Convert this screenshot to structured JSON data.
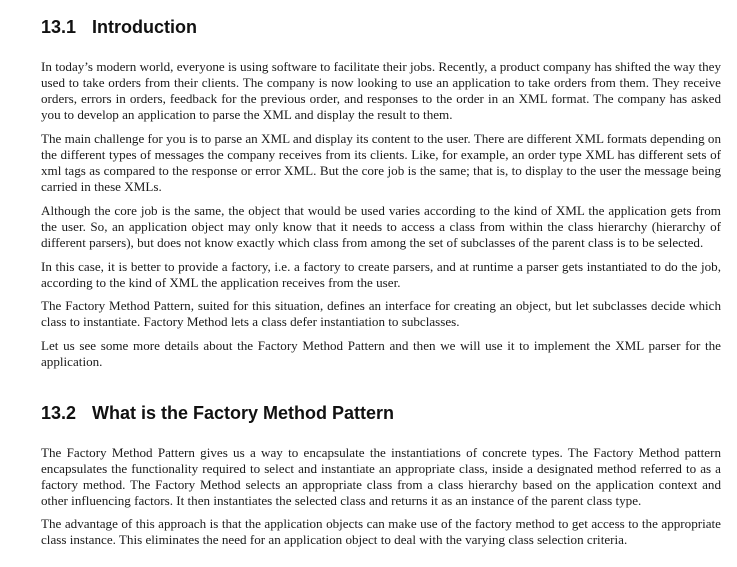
{
  "sections": [
    {
      "number": "13.1",
      "title": "Introduction",
      "paragraphs": [
        "In today’s modern world, everyone is using software to facilitate their jobs. Recently, a product company has shifted the way they used to take orders from their clients. The company is now looking to use an application to take orders from them. They receive orders, errors in orders, feedback for the previous order, and responses to the order in an XML format. The company has asked you to develop an application to parse the XML and display the result to them.",
        "The main challenge for you is to parse an XML and display its content to the user. There are different XML formats depending on the different types of messages the company receives from its clients. Like, for example, an order type XML has different sets of xml tags as compared to the response or error XML. But the core job is the same; that is, to display to the user the message being carried in these XMLs.",
        "Although the core job is the same, the object that would be used varies according to the kind of XML the application gets from the user. So, an application object may only know that it needs to access a class from within the class hierarchy (hierarchy of different parsers), but does not know exactly which class from among the set of subclasses of the parent class is to be selected.",
        "In this case, it is better to provide a factory, i.e. a factory to create parsers, and at runtime a parser gets instantiated to do the job, according to the kind of XML the application receives from the user.",
        "The Factory Method Pattern, suited for this situation, defines an interface for creating an object, but let subclasses decide which class to instantiate. Factory Method lets a class defer instantiation to subclasses.",
        "Let us see some more details about the Factory Method Pattern and then we will use it to implement the XML parser for the application."
      ]
    },
    {
      "number": "13.2",
      "title": "What is the Factory Method Pattern",
      "paragraphs": [
        "The Factory Method Pattern gives us a way to encapsulate the instantiations of concrete types. The Factory Method pattern encapsulates the functionality required to select and instantiate an appropriate class, inside a designated method referred to as a factory method. The Factory Method selects an appropriate class from a class hierarchy based on the application context and other influencing factors. It then instantiates the selected class and returns it as an instance of the parent class type.",
        "The advantage of this approach is that the application objects can make use of the factory method to get access to the appropriate class instance. This eliminates the need for an application object to deal with the varying class selection criteria."
      ]
    }
  ]
}
